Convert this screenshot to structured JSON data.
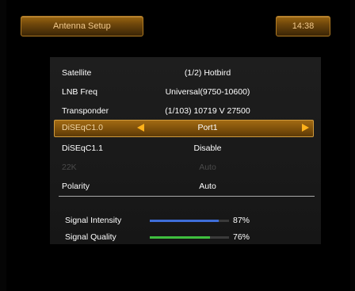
{
  "header": {
    "title": "Antenna Setup",
    "time": "14:38"
  },
  "settings": [
    {
      "label": "Satellite",
      "value": "(1/2) Hotbird"
    },
    {
      "label": "LNB Freq",
      "value": "Universal(9750-10600)"
    },
    {
      "label": "Transponder",
      "value": "(1/103) 10719 V 27500"
    },
    {
      "label": "DiSEqC1.0",
      "value": "Port1",
      "selected": true
    },
    {
      "label": "DiSEqC1.1",
      "value": "Disable"
    },
    {
      "label": "22K",
      "value": "Auto",
      "disabled": true
    },
    {
      "label": "Polarity",
      "value": "Auto"
    }
  ],
  "signal": {
    "intensity": {
      "label": "Signal Intensity",
      "percent_text": "87%",
      "level": 0.87
    },
    "quality": {
      "label": "Signal Quality",
      "percent_text": "76%",
      "level": 0.76
    }
  },
  "colors": {
    "accent": "#ffb21a",
    "intensity_bar": "#3f6ed8",
    "quality_bar": "#3fbf3f"
  },
  "icons": {
    "left": "arrow-left-icon",
    "right": "arrow-right-icon"
  }
}
